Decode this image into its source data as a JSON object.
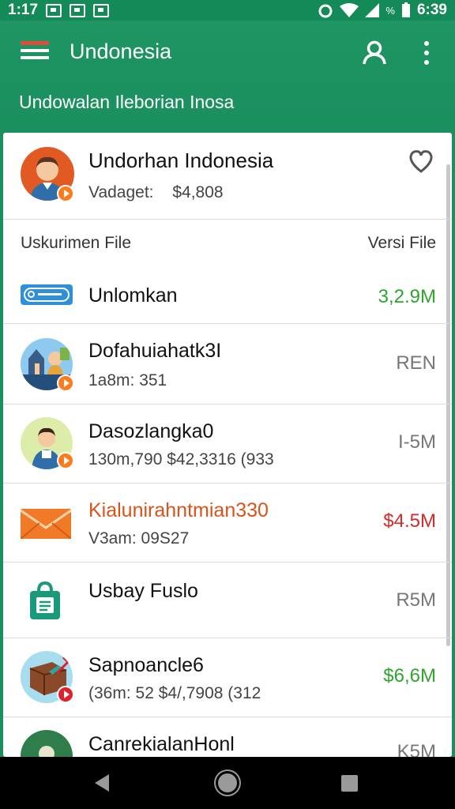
{
  "status_bar": {
    "time": "1:17",
    "battery_percent": "%",
    "clock_right": "6:39"
  },
  "app_bar": {
    "title": "Undonesia",
    "subtitle": "Undowalan  Ileborian Inosa"
  },
  "profile": {
    "name": "Undorhan Indonesia",
    "label": "Vadaget:",
    "amount": "$4,808"
  },
  "file_list": {
    "col_left": "Uskurimen File",
    "col_right": "Versi File",
    "items": [
      {
        "title": "Unlomkan",
        "sub": "",
        "value": "3,2.9M",
        "value_color": "#2ea52e",
        "title_color": "#111",
        "icon": "app-logo-icon"
      },
      {
        "title": "Dofahuiahatk3I",
        "sub": "1a8m: 351",
        "value": "REN",
        "value_color": "#777",
        "title_color": "#111",
        "icon": "city-avatar-icon"
      },
      {
        "title": "Dasozlangka0",
        "sub": "130m,790   $42,3316 (933",
        "value": "I-5M",
        "value_color": "#777",
        "title_color": "#111",
        "icon": "man-avatar-icon"
      },
      {
        "title": "Kialunirahntmian330",
        "sub": "V3am: 09S27",
        "value": "$4.5M",
        "value_color": "#d52a2a",
        "title_color": "#d8541a",
        "icon": "envelope-icon"
      },
      {
        "title": "Usbay Fuslo",
        "sub": "",
        "value": "R5M",
        "value_color": "#777",
        "title_color": "#111",
        "icon": "shopping-bag-icon"
      },
      {
        "title": "Sapnoancle6",
        "sub": "(36m: 52    $4/,7908 (312",
        "value": "$6,6M",
        "value_color": "#2ea52e",
        "title_color": "#111",
        "icon": "package-avatar-icon"
      },
      {
        "title": "CanrekialanHonl",
        "sub": "",
        "value": "K5M",
        "value_color": "#777",
        "title_color": "#111",
        "icon": "person-avatar-icon"
      }
    ]
  }
}
